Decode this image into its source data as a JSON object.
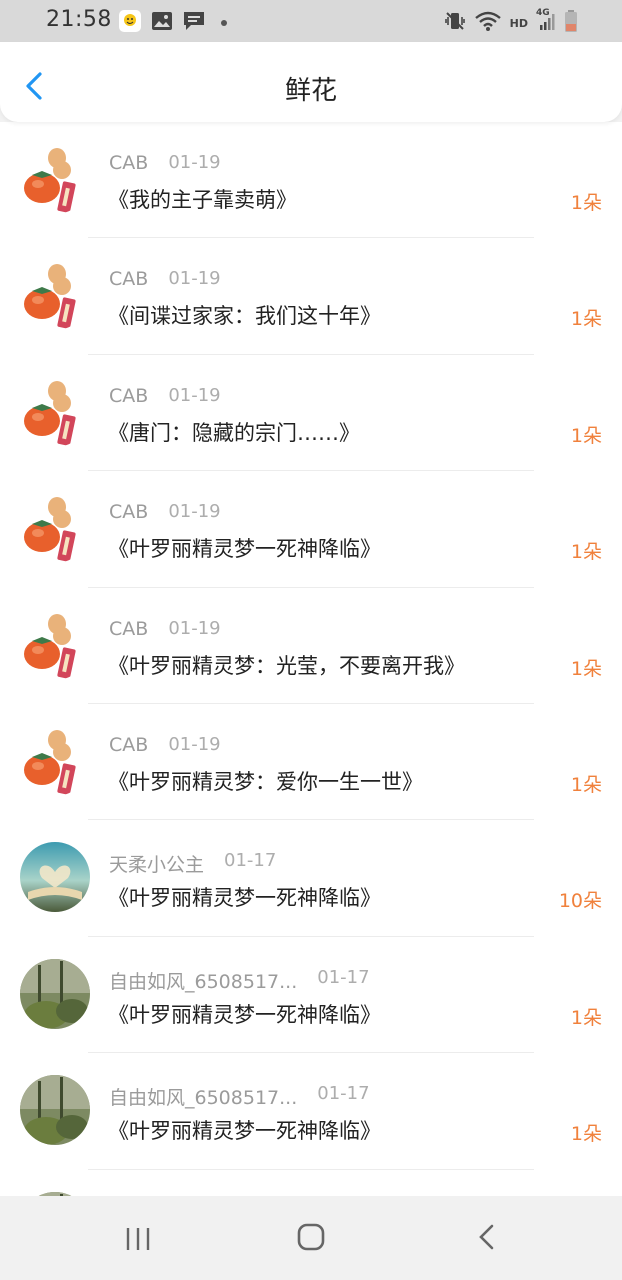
{
  "status_bar": {
    "time": "21:58",
    "icons_left": [
      "app-notification-icon",
      "image-icon",
      "message-icon",
      "dot-icon"
    ],
    "icons_right": [
      "vibrate-mute-icon",
      "wifi-icon",
      "hd-icon",
      "signal-4g-icon",
      "battery-icon"
    ],
    "hd_label": "HD",
    "network_label": "4G"
  },
  "header": {
    "title": "鲜花",
    "back_icon": "chevron-left-icon",
    "accent": "#2196f3"
  },
  "list": {
    "count_color": "#f0813c",
    "items": [
      {
        "user": "CAB",
        "date": "01-19",
        "book": "《我的主子靠卖萌》",
        "count": "1朵",
        "avatar": "persimmon"
      },
      {
        "user": "CAB",
        "date": "01-19",
        "book": "《间谍过家家：我们这十年》",
        "count": "1朵",
        "avatar": "persimmon"
      },
      {
        "user": "CAB",
        "date": "01-19",
        "book": "《唐门：隐藏的宗门……》",
        "count": "1朵",
        "avatar": "persimmon"
      },
      {
        "user": "CAB",
        "date": "01-19",
        "book": "《叶罗丽精灵梦一死神降临》",
        "count": "1朵",
        "avatar": "persimmon"
      },
      {
        "user": "CAB",
        "date": "01-19",
        "book": "《叶罗丽精灵梦：光莹，不要离开我》",
        "count": "1朵",
        "avatar": "persimmon"
      },
      {
        "user": "CAB",
        "date": "01-19",
        "book": "《叶罗丽精灵梦：爱你一生一世》",
        "count": "1朵",
        "avatar": "persimmon"
      },
      {
        "user": "天柔小公主",
        "date": "01-17",
        "book": "《叶罗丽精灵梦一死神降临》",
        "count": "10朵",
        "avatar": "book-heart"
      },
      {
        "user": "自由如风_6508517...",
        "date": "01-17",
        "book": "《叶罗丽精灵梦一死神降临》",
        "count": "1朵",
        "avatar": "forest"
      },
      {
        "user": "自由如风_6508517...",
        "date": "01-17",
        "book": "《叶罗丽精灵梦一死神降临》",
        "count": "1朵",
        "avatar": "forest"
      }
    ]
  },
  "nav_bar": {
    "recent_icon": "recent-apps-icon",
    "home_icon": "home-icon",
    "back_icon": "back-icon"
  }
}
